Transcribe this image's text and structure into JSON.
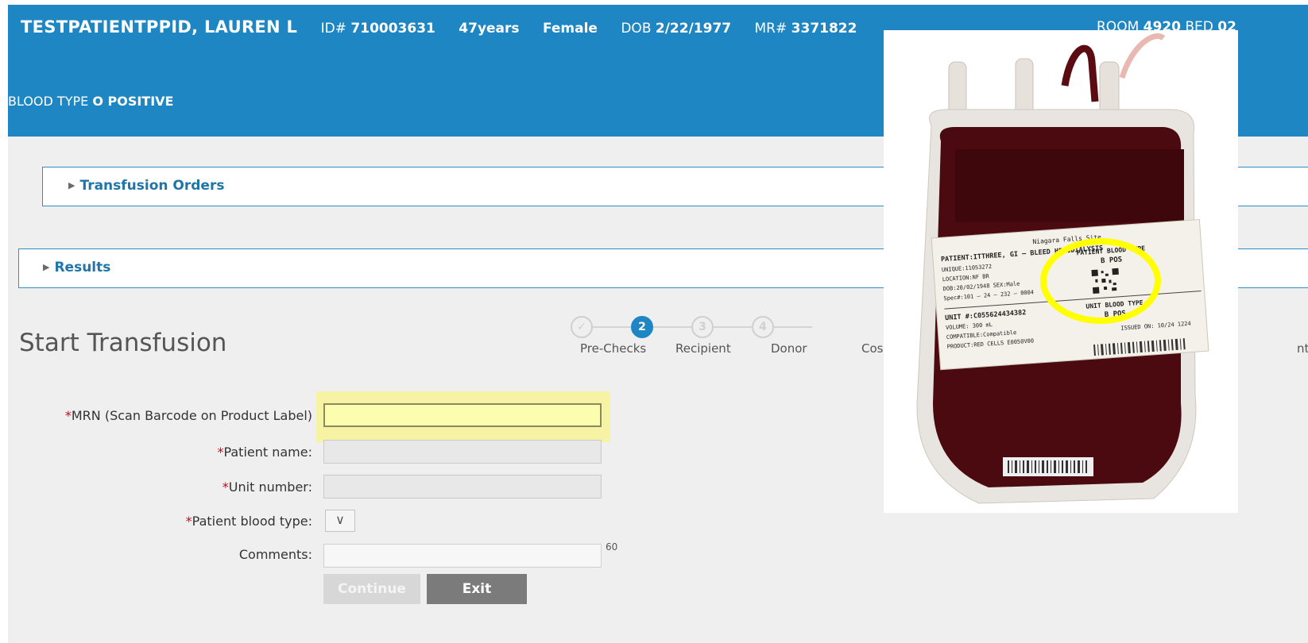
{
  "header": {
    "patient_name": "TESTPATIENTPPID, LAUREN L",
    "id_label": "ID#",
    "id_value": "710003631",
    "age": "47years",
    "sex": "Female",
    "dob_label": "DOB",
    "dob_value": "2/22/1977",
    "mr_label": "MR#",
    "mr_value": "3371822",
    "room_label": "ROOM",
    "room_value": "4920",
    "bed_label": "BED",
    "bed_value": "02",
    "blood_type_label": "BLOOD TYPE",
    "blood_type_value": "O POSITIVE",
    "bg_color": "#1e86c2"
  },
  "panels": [
    {
      "label": "Transfusion Orders"
    },
    {
      "label": "Results"
    }
  ],
  "page_title": "Start Transfusion",
  "stepper": {
    "active_step": 2,
    "steps": [
      {
        "number": "",
        "label": "Pre-Checks",
        "state": "done"
      },
      {
        "number": "2",
        "label": "Recipient",
        "state": "active"
      },
      {
        "number": "3",
        "label": "Donor",
        "state": "pending"
      },
      {
        "number": "4",
        "label": "Cos",
        "state": "pending"
      }
    ],
    "last_step_label_fragment": "nt"
  },
  "form": {
    "mrn_label": "MRN (Scan Barcode on Product Label)",
    "mrn_value": "",
    "patient_name_label": "Patient name:",
    "patient_name_value": "",
    "unit_number_label": "Unit number:",
    "unit_number_value": "",
    "blood_type_label": "Patient blood type:",
    "comments_label": "Comments:",
    "comments_value": "",
    "comments_limit": "60",
    "required_marker": "*",
    "continue_label": "Continue",
    "exit_label": "Exit"
  },
  "overlay_photo": {
    "label": {
      "site": "Niagara Falls Site",
      "patient_line": "PATIENT:ITTHREE, GI — BLEED HEMODIALYSIS",
      "unique_line": "UNIQUE:11053272",
      "location_line": "LOCATION:NF BR",
      "dob_line": "DOB:20/02/1948 SEX:Male",
      "spec_line": "Spec#:101 – 24 – 232 – 0004",
      "patient_blood_header": "PATIENT BLOOD TYPE",
      "patient_blood_value": "B POS",
      "unit_line": "UNIT #:C055624434382",
      "volume_line": "VOLUME: 300 mL",
      "compatible_line": "COMPATIBLE:Compatible",
      "product_line": "PRODUCT:RED CELLS E0050V00",
      "unit_blood_header": "UNIT BLOOD TYPE",
      "unit_blood_value": "B POS",
      "issued_line": "ISSUED ON: 10/24 1224"
    },
    "highlight_color": "#ffff00"
  },
  "colors": {
    "accent": "#1e86c2",
    "required": "#d0021b",
    "mrn_field": "#fdfdb0",
    "highlight": "#f6f3a4"
  }
}
